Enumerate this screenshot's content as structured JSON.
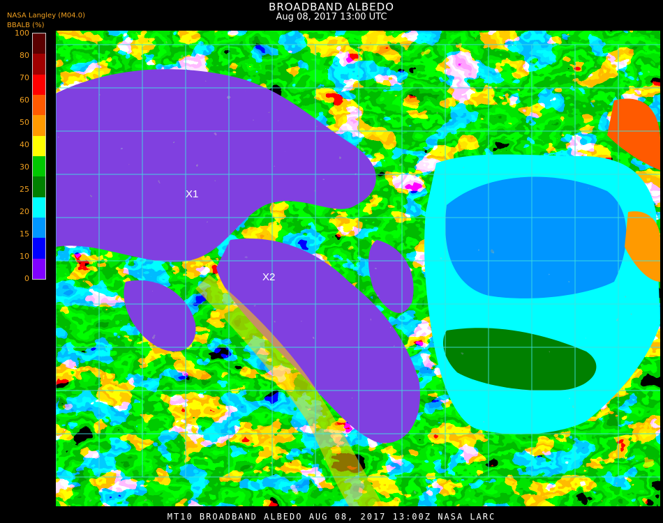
{
  "header": {
    "title": "BROADBAND ALBEDO",
    "subtitle": "Aug 08, 2017 13:00 UTC",
    "credit": "NASA Langley (M04.0)"
  },
  "colorbar": {
    "label": "BBALB (%)",
    "ticks": [
      "100",
      "80",
      "70",
      "60",
      "50",
      "40",
      "30",
      "25",
      "20",
      "15",
      "10",
      "0"
    ],
    "colors": [
      "#5a0000",
      "#a00000",
      "#ff0000",
      "#ff5a00",
      "#ff9a00",
      "#ffff00",
      "#00c800",
      "#008000",
      "#00ffff",
      "#0096ff",
      "#0000ff",
      "#8000ff"
    ]
  },
  "markers": [
    {
      "label": "X1"
    },
    {
      "label": "X2"
    }
  ],
  "footer": "MT10  BROADBAND ALBEDO   AUG 08, 2017 13:00Z   NASA LARC"
}
